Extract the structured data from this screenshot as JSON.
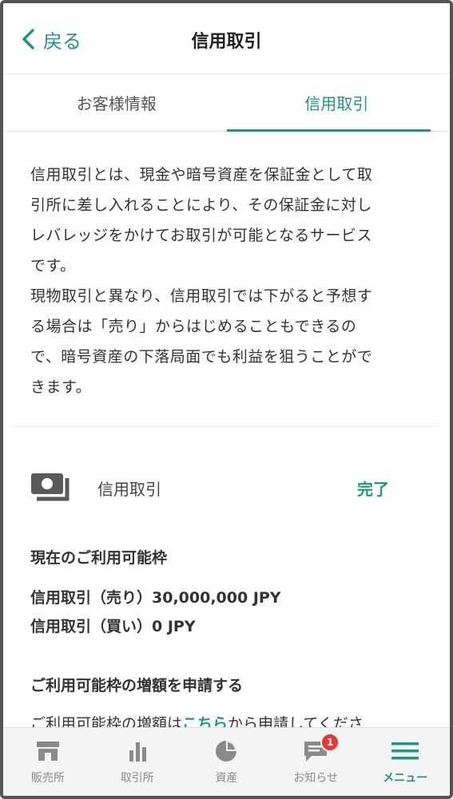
{
  "header": {
    "back_label": "戻る",
    "title": "信用取引"
  },
  "tabs": [
    {
      "label": "お客様情報",
      "active": false
    },
    {
      "label": "信用取引",
      "active": true
    }
  ],
  "description": {
    "paragraph1": "信用取引とは、現金や暗号資産を保証金として取\n引所に差し入れることにより、その保証金に対し\nレバレッジをかけてお取引が可能となるサービス\nです。",
    "paragraph2": "現物取引と異なり、信用取引では下がると予想す\nる場合は「売り」からはじめることもできるの\nで、暗号資産の下落局面でも利益を狙うことがで\nきます。"
  },
  "status": {
    "label": "信用取引",
    "value": "完了"
  },
  "limits": {
    "heading": "現在のご利用可能枠",
    "sell": "信用取引（売り）30,000,000 JPY",
    "buy": "信用取引（買い）0 JPY"
  },
  "increase": {
    "heading": "ご利用可能枠の増額を申請する",
    "text_before": "ご利用可能枠の増額は",
    "link": "こちら",
    "text_after": "から申請してくださ"
  },
  "bottom_nav": {
    "items": [
      {
        "label": "販売所",
        "icon": "store-icon"
      },
      {
        "label": "取引所",
        "icon": "bar-chart-icon"
      },
      {
        "label": "資産",
        "icon": "pie-chart-icon"
      },
      {
        "label": "お知らせ",
        "icon": "message-icon",
        "badge": "1"
      },
      {
        "label": "メニュー",
        "icon": "hamburger-menu-icon",
        "active": true
      }
    ]
  },
  "colors": {
    "accent": "#1e9683",
    "badge": "#e53935"
  }
}
